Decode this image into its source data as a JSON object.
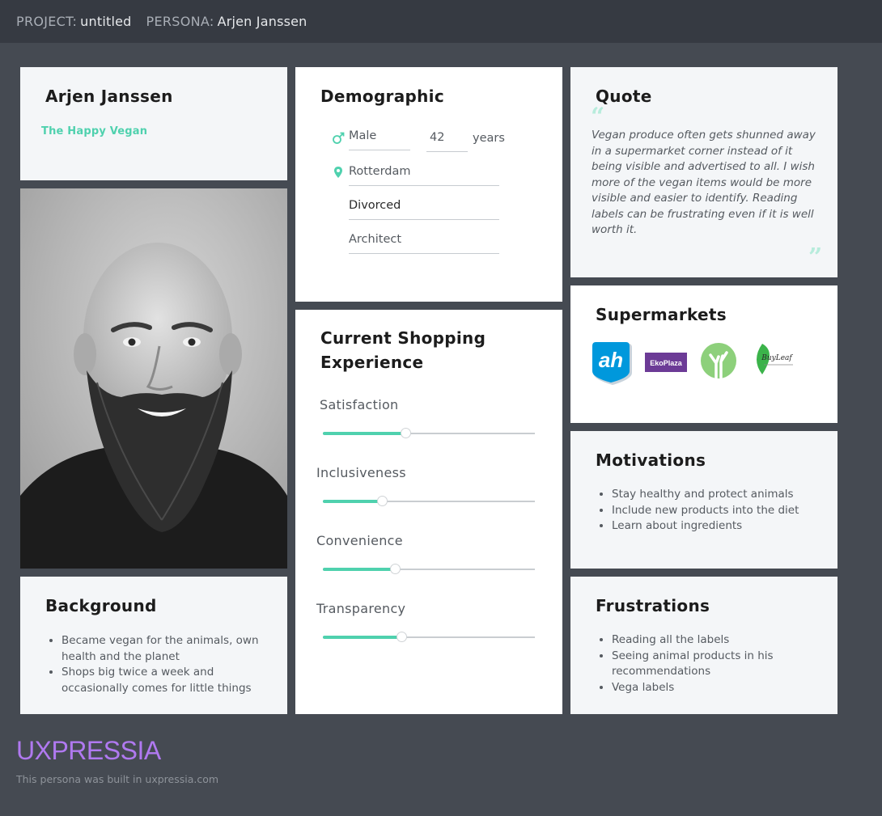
{
  "header": {
    "project_label": "PROJECT:",
    "project_value": "untitled",
    "persona_label": "PERSONA:",
    "persona_value": "Arjen Janssen"
  },
  "persona": {
    "name": "Arjen Janssen",
    "tagline": "The Happy Vegan"
  },
  "background": {
    "title": "Background",
    "items": [
      "Became vegan for the animals, own health and the planet",
      "Shops big twice a week and occasionally comes for little things"
    ]
  },
  "demographic": {
    "title": "Demographic",
    "gender": "Male",
    "age": "42",
    "age_unit": "years",
    "location": "Rotterdam",
    "status": "Divorced",
    "occupation": "Architect"
  },
  "shopping": {
    "title": "Current Shopping Experience",
    "sliders": [
      {
        "label": "Satisfaction",
        "value": 0.39
      },
      {
        "label": "Inclusiveness",
        "value": 0.28
      },
      {
        "label": "Convenience",
        "value": 0.34
      },
      {
        "label": "Transparency",
        "value": 0.37
      }
    ]
  },
  "quote": {
    "title": "Quote",
    "text": "Vegan produce often gets shunned away in a supermarket corner instead of it being visible and advertised to all. I wish more of the vegan items would be more visible and easier to identify. Reading labels can be frustrating even if it is well worth it.",
    "open_mark": "“",
    "close_mark": "”"
  },
  "supermarkets": {
    "title": "Supermarkets",
    "logos": [
      {
        "name": "ah-logo",
        "text": "ah"
      },
      {
        "name": "ekoplaza-logo",
        "text": "EkoPlaza"
      },
      {
        "name": "tree-logo",
        "text": ""
      },
      {
        "name": "buyleaf-logo",
        "text": "BuyLeaf"
      }
    ]
  },
  "motivations": {
    "title": "Motivations",
    "items": [
      "Stay healthy and protect animals",
      "Include new products into the diet",
      "Learn about ingredients"
    ]
  },
  "frustrations": {
    "title": "Frustrations",
    "items": [
      "Reading all the labels",
      "Seeing animal products in his recommendations",
      "Vega labels"
    ]
  },
  "footer": {
    "brand": "UXPRESSIA",
    "built_text": "This persona was built in uxpressia.com"
  },
  "colors": {
    "accent": "#4fd1ae",
    "brand": "#b079f0",
    "page_bg": "#454a52",
    "header_bg": "#363a42"
  }
}
